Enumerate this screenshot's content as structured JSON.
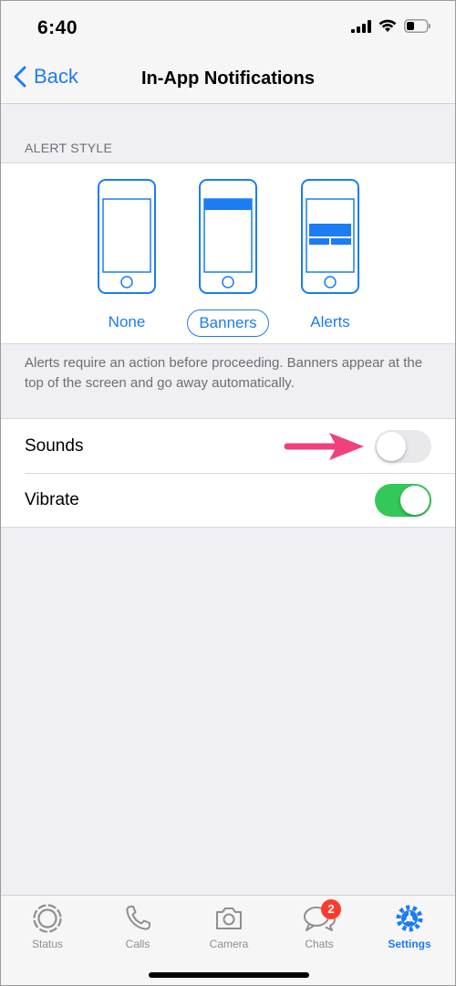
{
  "status_bar": {
    "time": "6:40",
    "icons": [
      "signal-icon",
      "wifi-icon",
      "battery-icon"
    ]
  },
  "nav": {
    "back_label": "Back",
    "title": "In-App Notifications"
  },
  "alert_style": {
    "header": "ALERT STYLE",
    "options": [
      {
        "label": "None",
        "selected": false
      },
      {
        "label": "Banners",
        "selected": true
      },
      {
        "label": "Alerts",
        "selected": false
      }
    ],
    "note": "Alerts require an action before proceeding. Banners appear at the top of the screen and go away automatically."
  },
  "settings": [
    {
      "label": "Sounds",
      "on": false
    },
    {
      "label": "Vibrate",
      "on": true
    }
  ],
  "tabs": [
    {
      "label": "Status",
      "icon": "status-icon",
      "active": false
    },
    {
      "label": "Calls",
      "icon": "phone-icon",
      "active": false
    },
    {
      "label": "Camera",
      "icon": "camera-icon",
      "active": false
    },
    {
      "label": "Chats",
      "icon": "chat-icon",
      "active": false,
      "badge": "2"
    },
    {
      "label": "Settings",
      "icon": "gear-icon",
      "active": true
    }
  ],
  "colors": {
    "accent": "#1c7cf4",
    "toggle_on": "#34c759",
    "badge": "#ff3b30",
    "arrow": "#f23f7d"
  }
}
